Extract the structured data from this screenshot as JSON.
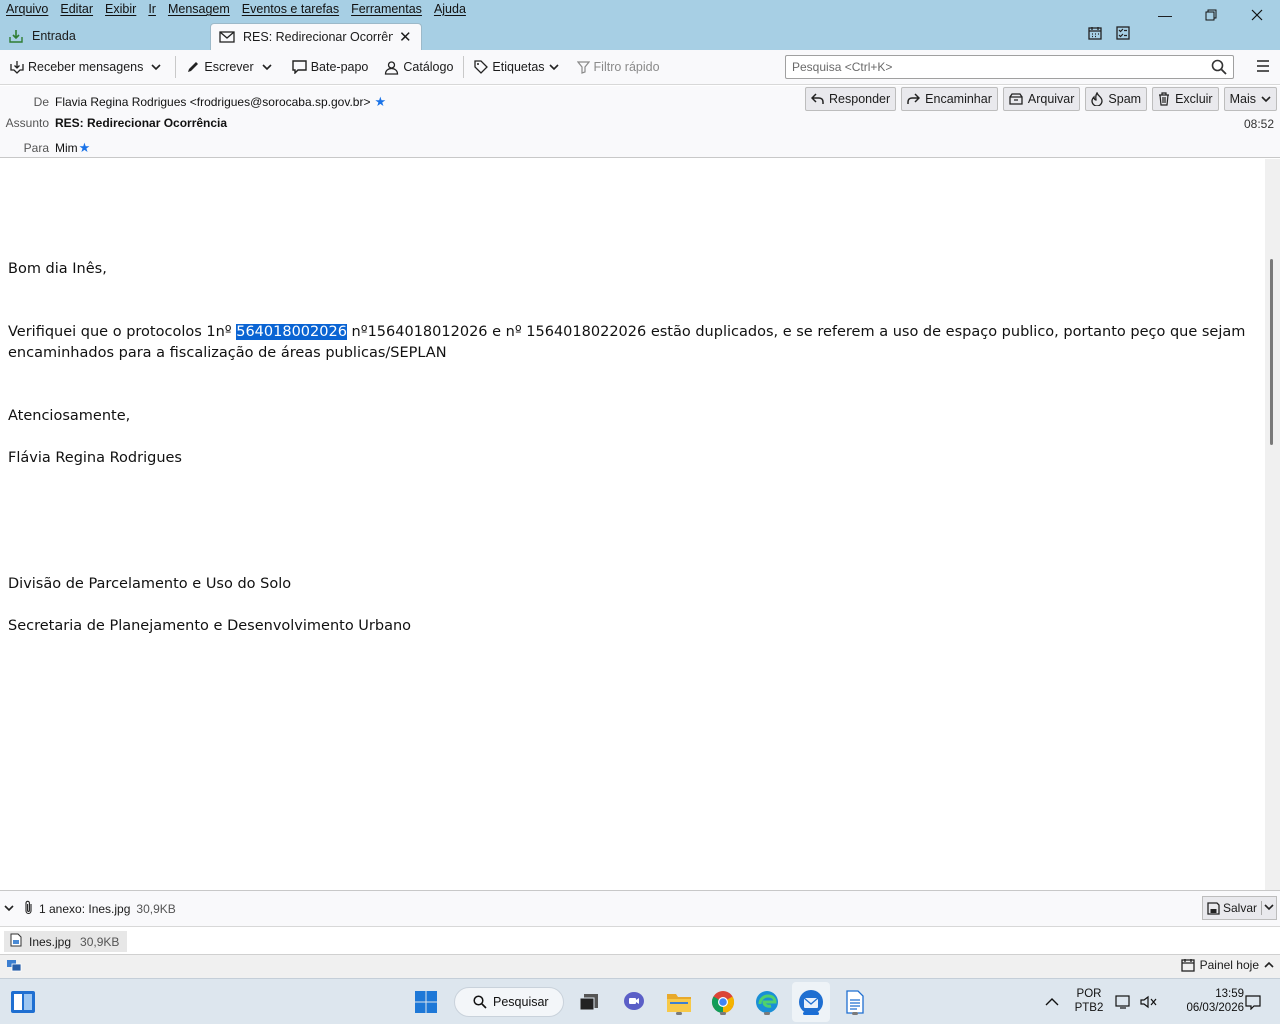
{
  "menu": {
    "items": [
      "Arquivo",
      "Editar",
      "Exibir",
      "Ir",
      "Mensagem",
      "Eventos e tarefas",
      "Ferramentas",
      "Ajuda"
    ]
  },
  "tabs": [
    {
      "label": "Entrada"
    },
    {
      "label": "RES: Redirecionar Ocorrência"
    }
  ],
  "toolbar": {
    "get_messages": "Receber mensagens",
    "write": "Escrever",
    "chat": "Bate-papo",
    "address_book": "Catálogo",
    "tags": "Etiquetas",
    "quick_filter": "Filtro rápido",
    "search_placeholder": "Pesquisa <Ctrl+K>"
  },
  "header": {
    "from_label": "De",
    "from_value": "Flavia Regina Rodrigues <frodrigues@sorocaba.sp.gov.br>",
    "subject_label": "Assunto",
    "subject_value": "RES: Redirecionar Ocorrência",
    "to_label": "Para",
    "to_value": "Mim",
    "time": "08:52",
    "actions": {
      "reply": "Responder",
      "forward": "Encaminhar",
      "archive": "Arquivar",
      "junk": "Spam",
      "delete": "Excluir",
      "more": "Mais"
    }
  },
  "body": {
    "greeting": "Bom dia Inês,",
    "line1_before": "Verifiquei que o protocolos 1nº ",
    "line1_selected": "564018002026",
    "line1_after": " nº1564018012026 e nº 1564018022026 estão duplicados, e se referem a uso de espaço publico, portanto peço que sejam",
    "line2": "encaminhados para a fiscalização de áreas publicas/SEPLAN",
    "closing": "Atenciosamente,",
    "signature_name": "Flávia Regina Rodrigues",
    "division": "Divisão de Parcelamento e Uso do Solo",
    "secretariat": "Secretaria de Planejamento e Desenvolvimento Urbano"
  },
  "attachments": {
    "summary": "1 anexo: Ines.jpg",
    "summary_size": "30,9KB",
    "save": "Salvar",
    "item_name": "Ines.jpg",
    "item_size": "30,9KB"
  },
  "status": {
    "today_pane": "Painel hoje"
  },
  "taskbar": {
    "search": "Pesquisar",
    "lang_top": "POR",
    "lang_bottom": "PTB2",
    "clock_time": "13:59",
    "clock_date": "06/03/2026"
  },
  "colors": {
    "titlebar": "#a7cfe4",
    "selection": "#0a64d3",
    "star": "#1a73e8"
  }
}
